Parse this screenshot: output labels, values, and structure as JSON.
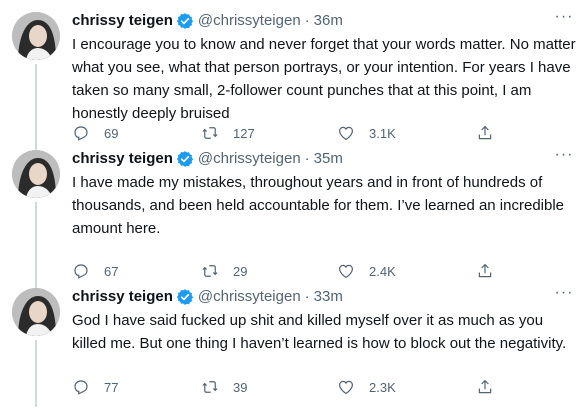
{
  "tweets": [
    {
      "author": "chrissy teigen",
      "handle": "@chrissyteigen",
      "separator": "·",
      "time": "36m",
      "text": "I encourage you to know and never forget that your words matter. No matter what you see, what that person portrays, or your intention. For years I have taken so many small, 2-follower count punches that at this point, I am honestly deeply bruised",
      "replies": "69",
      "retweets": "127",
      "likes": "3.1K"
    },
    {
      "author": "chrissy teigen",
      "handle": "@chrissyteigen",
      "separator": "·",
      "time": "35m",
      "text": "I have made my mistakes, throughout years and in front of hundreds of thousands, and been held accountable for them. I’ve learned an incredible amount here.",
      "replies": "67",
      "retweets": "29",
      "likes": "2.4K"
    },
    {
      "author": "chrissy teigen",
      "handle": "@chrissyteigen",
      "separator": "·",
      "time": "33m",
      "text": "God I have said fucked up shit and killed myself over it as much as you killed me. But one thing I haven’t learned is how to block out the negativity.",
      "replies": "77",
      "retweets": "39",
      "likes": "2.3K"
    }
  ],
  "colors": {
    "text": "#0f1419",
    "secondary": "#536471",
    "verified": "#1d9bf0",
    "thread_line": "#cfd9de"
  },
  "icons": [
    "verified-badge-icon",
    "more-icon",
    "reply-icon",
    "retweet-icon",
    "like-icon",
    "share-icon"
  ]
}
